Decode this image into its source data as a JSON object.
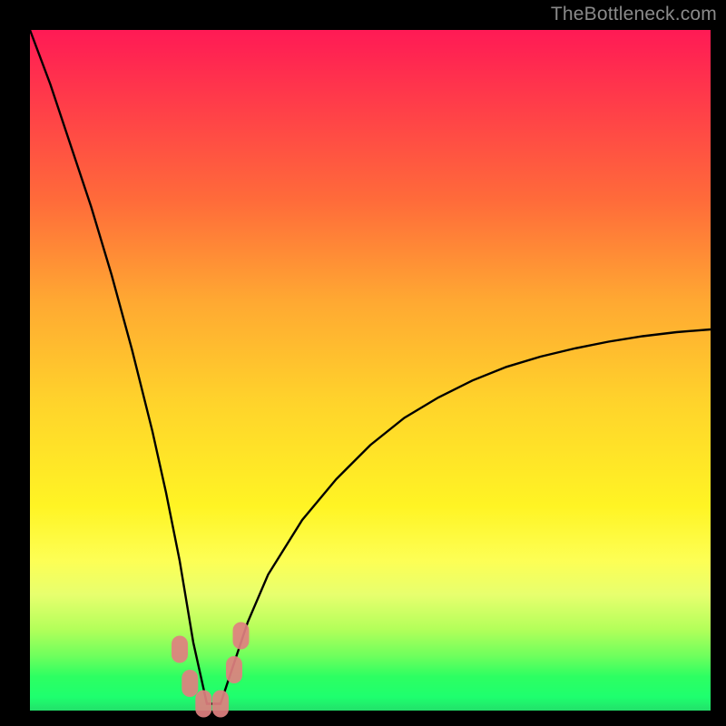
{
  "watermark": "TheBottleneck.com",
  "colors": {
    "frame": "#000000",
    "curve": "#000000",
    "markers": "#e08080",
    "gradient_top": "#ff1a55",
    "gradient_bottom": "#22e06a"
  },
  "chart_data": {
    "type": "line",
    "title": "",
    "xlabel": "",
    "ylabel": "",
    "xlim": [
      0,
      100
    ],
    "ylim": [
      0,
      100
    ],
    "grid": false,
    "legend": false,
    "note": "No axis ticks or labels are rendered; values estimated from geometry. Curve shows a |bottleneck-%|-like V with minimum near x≈26, y≈0, rising toward ~100 at x=0 and ~55 at x=100.",
    "series": [
      {
        "name": "bottleneck-curve",
        "x": [
          0,
          3,
          6,
          9,
          12,
          15,
          18,
          20,
          22,
          24,
          26,
          28,
          30,
          32,
          35,
          40,
          45,
          50,
          55,
          60,
          65,
          70,
          75,
          80,
          85,
          90,
          95,
          100
        ],
        "y": [
          100,
          92,
          83,
          74,
          64,
          53,
          41,
          32,
          22,
          10,
          1,
          1,
          7,
          13,
          20,
          28,
          34,
          39,
          43,
          46,
          48.5,
          50.5,
          52,
          53.2,
          54.2,
          55,
          55.6,
          56
        ]
      }
    ],
    "markers": [
      {
        "x": 22.0,
        "y": 9.0
      },
      {
        "x": 23.5,
        "y": 4.0
      },
      {
        "x": 25.5,
        "y": 1.0
      },
      {
        "x": 28.0,
        "y": 1.0
      },
      {
        "x": 30.0,
        "y": 6.0
      },
      {
        "x": 31.0,
        "y": 11.0
      }
    ]
  }
}
